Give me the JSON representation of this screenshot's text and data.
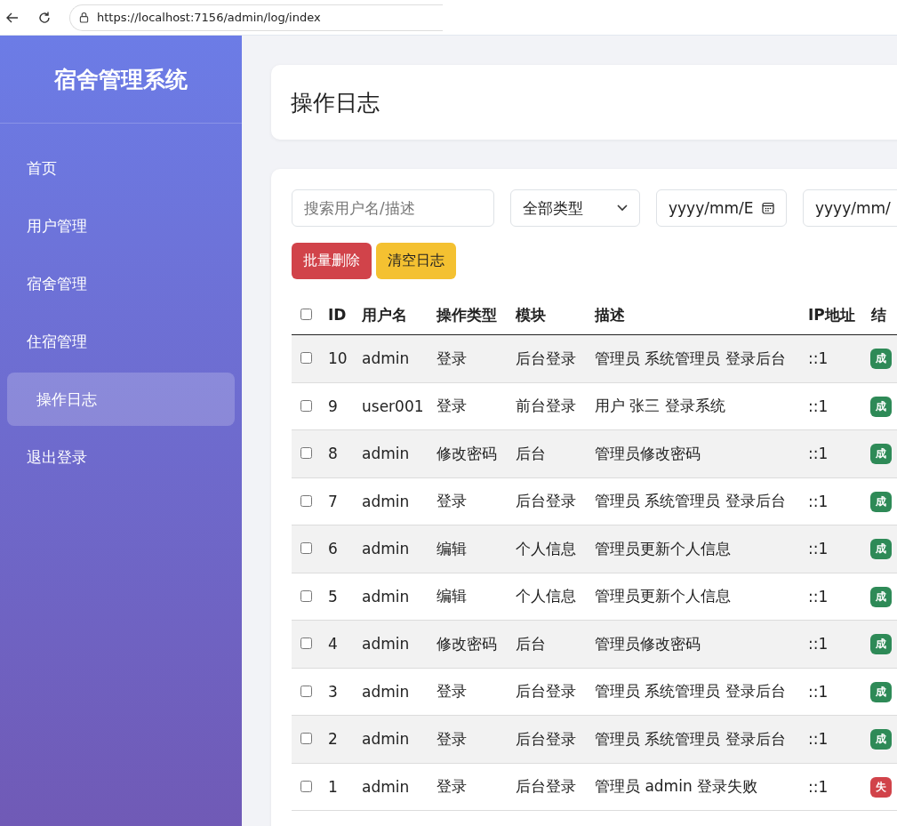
{
  "browser": {
    "url": "https://localhost:7156/admin/log/index"
  },
  "sidebar": {
    "title": "宿舍管理系统",
    "items": [
      {
        "label": "首页",
        "selected": false
      },
      {
        "label": "用户管理",
        "selected": false
      },
      {
        "label": "宿舍管理",
        "selected": false
      },
      {
        "label": "住宿管理",
        "selected": false
      },
      {
        "label": "操作日志",
        "selected": true
      },
      {
        "label": "退出登录",
        "selected": false
      }
    ]
  },
  "page_title": "操作日志",
  "filters": {
    "search": {
      "placeholder": "搜索用户名/描述"
    },
    "type_select": {
      "value": "全部类型"
    },
    "date_from": {
      "placeholder": "yyyy/mm/E"
    },
    "date_to": {
      "placeholder": "yyyy/mm/"
    }
  },
  "buttons": [
    {
      "label": "批量删除",
      "kind": "danger"
    },
    {
      "label": "清空日志",
      "kind": "warning"
    }
  ],
  "table": {
    "select_all": {
      "checked": false
    },
    "columns": [
      "ID",
      "用户名",
      "操作类型",
      "模块",
      "描述",
      "IP地址",
      "结"
    ],
    "rows": [
      {
        "checked": false,
        "id": "10",
        "user": "admin",
        "type": "登录",
        "module": "后台登录",
        "desc": "管理员 系统管理员 登录后台",
        "ip": "::1",
        "result": "成",
        "success": true
      },
      {
        "checked": false,
        "id": "9",
        "user": "user001",
        "type": "登录",
        "module": "前台登录",
        "desc": "用户 张三 登录系统",
        "ip": "::1",
        "result": "成",
        "success": true
      },
      {
        "checked": false,
        "id": "8",
        "user": "admin",
        "type": "修改密码",
        "module": "后台",
        "desc": "管理员修改密码",
        "ip": "::1",
        "result": "成",
        "success": true
      },
      {
        "checked": false,
        "id": "7",
        "user": "admin",
        "type": "登录",
        "module": "后台登录",
        "desc": "管理员 系统管理员 登录后台",
        "ip": "::1",
        "result": "成",
        "success": true
      },
      {
        "checked": false,
        "id": "6",
        "user": "admin",
        "type": "编辑",
        "module": "个人信息",
        "desc": "管理员更新个人信息",
        "ip": "::1",
        "result": "成",
        "success": true
      },
      {
        "checked": false,
        "id": "5",
        "user": "admin",
        "type": "编辑",
        "module": "个人信息",
        "desc": "管理员更新个人信息",
        "ip": "::1",
        "result": "成",
        "success": true
      },
      {
        "checked": false,
        "id": "4",
        "user": "admin",
        "type": "修改密码",
        "module": "后台",
        "desc": "管理员修改密码",
        "ip": "::1",
        "result": "成",
        "success": true
      },
      {
        "checked": false,
        "id": "3",
        "user": "admin",
        "type": "登录",
        "module": "后台登录",
        "desc": "管理员 系统管理员 登录后台",
        "ip": "::1",
        "result": "成",
        "success": true
      },
      {
        "checked": false,
        "id": "2",
        "user": "admin",
        "type": "登录",
        "module": "后台登录",
        "desc": "管理员 系统管理员 登录后台",
        "ip": "::1",
        "result": "成",
        "success": true
      },
      {
        "checked": false,
        "id": "1",
        "user": "admin",
        "type": "登录",
        "module": "后台登录",
        "desc": "管理员 admin 登录失败",
        "ip": "::1",
        "result": "失",
        "success": false
      }
    ]
  }
}
